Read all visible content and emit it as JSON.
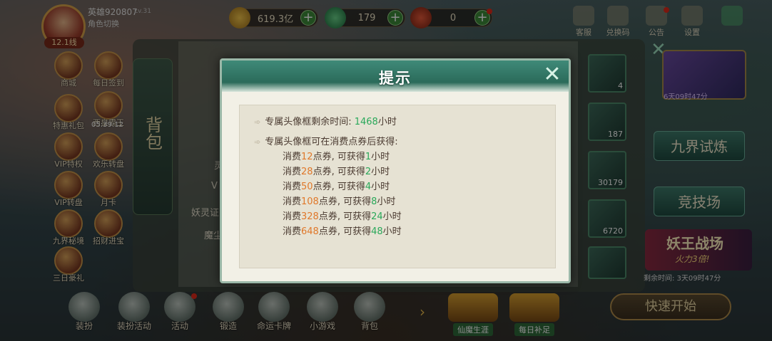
{
  "player": {
    "name": "英雄920807",
    "lv": "Lv.31",
    "level_badge": "12.1线",
    "switch_role": "角色切换"
  },
  "currencies": [
    {
      "icon": "gold-coin-icon",
      "value": "619.3亿"
    },
    {
      "icon": "jade-icon",
      "value": "179"
    },
    {
      "icon": "voucher-icon",
      "value": "0"
    }
  ],
  "top_right": [
    {
      "icon": "service-icon",
      "label": "客服"
    },
    {
      "icon": "exchange-code-icon",
      "label": "兑换码"
    },
    {
      "icon": "notice-icon",
      "label": "公告"
    },
    {
      "icon": "settings-icon",
      "label": "设置"
    },
    {
      "icon": "exit-icon",
      "label": ""
    }
  ],
  "left_menu": [
    {
      "label": "商城"
    },
    {
      "label": "每日签到"
    },
    {
      "label": "特惠礼包"
    },
    {
      "label": "西皇霸王"
    },
    {
      "label": "VIP特权"
    },
    {
      "label": "欢乐转盘"
    },
    {
      "label": "VIP转盘"
    },
    {
      "label": "月卡"
    },
    {
      "label": "九界秘境"
    },
    {
      "label": "招财进宝"
    },
    {
      "label": "三日豪礼"
    }
  ],
  "left_menu_timer": "05:39:12",
  "bag": {
    "tab_label": "背包",
    "texts": [
      "灵",
      "V",
      "妖灵证",
      "魔尘"
    ],
    "items": [
      {
        "qty": "4"
      },
      {
        "qty": "187"
      },
      {
        "qty": "30179"
      },
      {
        "qty": "6720"
      },
      {
        "qty": ""
      }
    ]
  },
  "right_side": {
    "card_time": "6天09时47分",
    "trial": "九界试炼",
    "arena": "竞技场",
    "yao_title": "妖王战场",
    "yao_sub": "火力3倍!",
    "yao_time": "剩余时间: 3天09时47分",
    "quick_start": "快速开始"
  },
  "bottom_nav": [
    {
      "icon": "equip-icon",
      "label": "装扮"
    },
    {
      "icon": "gift-icon",
      "label": "装扮活动"
    },
    {
      "icon": "activity-icon",
      "label": "活动"
    },
    {
      "icon": "forge-icon",
      "label": "锻造"
    },
    {
      "icon": "card-icon",
      "label": "命运卡牌"
    },
    {
      "icon": "minigame-icon",
      "label": "小游戏"
    },
    {
      "icon": "bag-icon",
      "label": "背包"
    }
  ],
  "bottom_nav_big": [
    {
      "icon": "immortal-career-icon",
      "label": "仙魔生涯"
    },
    {
      "icon": "daily-supply-icon",
      "label": "每日补足"
    }
  ],
  "modal": {
    "title": "提示",
    "close_icon": "close-icon",
    "remaining_label": "专属头像框剩余时间: ",
    "remaining_value": "1468",
    "remaining_unit": "小时",
    "consume_header": "专属头像框可在消费点券后获得:",
    "tiers": [
      {
        "pre": "消费",
        "amount": "12",
        "mid": "点券, 可获得",
        "hours": "1",
        "unit": "小时"
      },
      {
        "pre": "消费",
        "amount": "28",
        "mid": "点券, 可获得",
        "hours": "2",
        "unit": "小时"
      },
      {
        "pre": "消费",
        "amount": "50",
        "mid": "点券, 可获得",
        "hours": "4",
        "unit": "小时"
      },
      {
        "pre": "消费",
        "amount": "108",
        "mid": "点券, 可获得",
        "hours": "8",
        "unit": "小时"
      },
      {
        "pre": "消费",
        "amount": "328",
        "mid": "点券, 可获得",
        "hours": "24",
        "unit": "小时"
      },
      {
        "pre": "消费",
        "amount": "648",
        "mid": "点券, 可获得",
        "hours": "48",
        "unit": "小时"
      }
    ]
  },
  "colors": {
    "highlight_green": "#2aa85a",
    "highlight_orange": "#e0782a",
    "modal_header": "#2b6b5a"
  }
}
